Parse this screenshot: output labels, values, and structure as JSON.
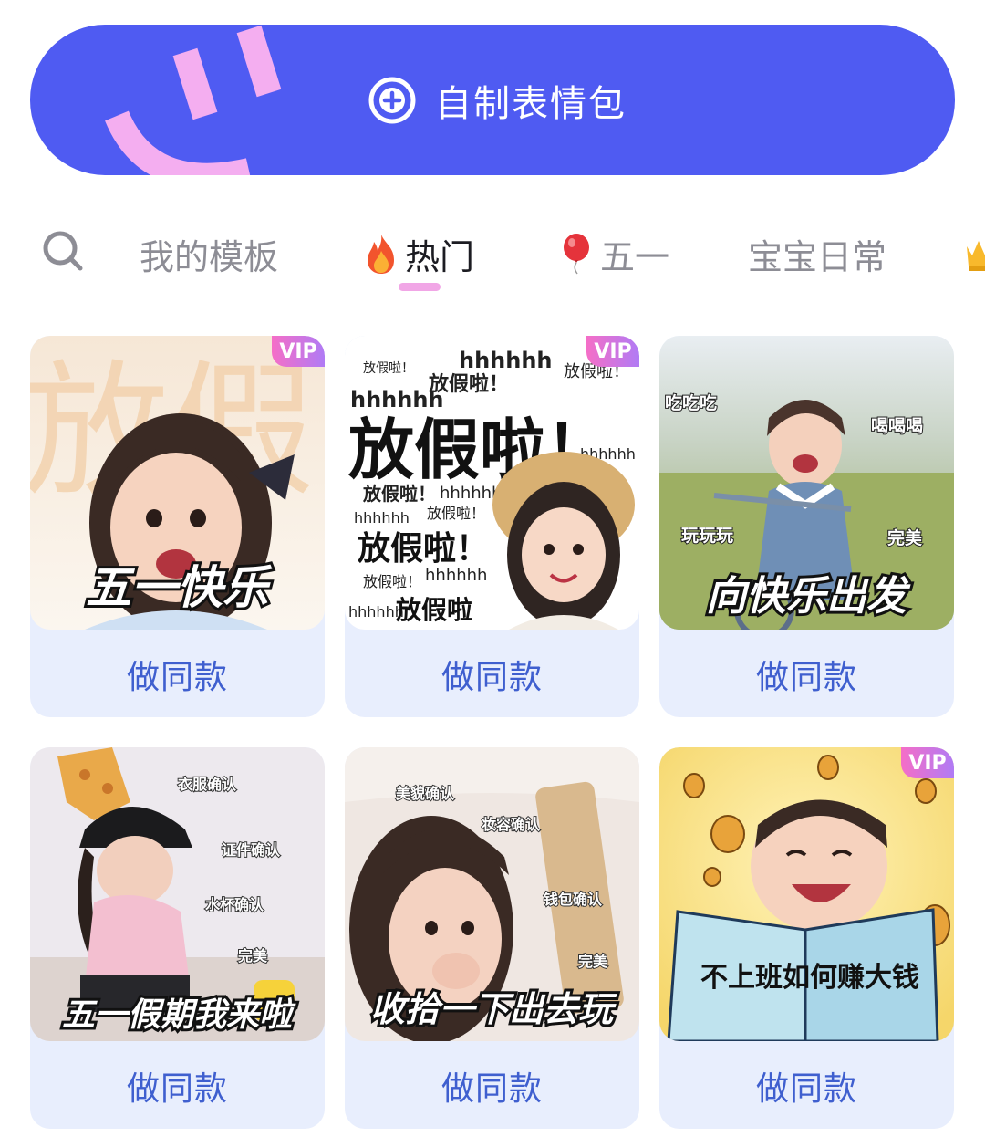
{
  "create_button": {
    "label": "自制表情包"
  },
  "tabs": [
    {
      "label": "我的模板",
      "emoji": ""
    },
    {
      "label": "热门",
      "emoji": "fire-icon"
    },
    {
      "label": "五一",
      "emoji": "balloon-icon"
    },
    {
      "label": "宝宝日常",
      "emoji": ""
    }
  ],
  "active_tab": "热门",
  "colors": {
    "accent": "#4F5BF2",
    "indicator": "#F1A6E6",
    "card_bg": "#E8EEFD",
    "action_text": "#3F5FCF"
  },
  "templates": [
    {
      "caption": "五一快乐",
      "background_text": "放假",
      "vip": "VIP",
      "action": "做同款"
    },
    {
      "caption": "放假啦！",
      "background_text": "hhhhhh",
      "vip": "VIP",
      "action": "做同款"
    },
    {
      "caption": "向快乐出发",
      "stickers": [
        "吃吃吃",
        "喝喝喝",
        "玩玩玩",
        "完美"
      ],
      "action": "做同款"
    },
    {
      "caption": "五一假期我来啦",
      "stickers": [
        "衣服确认",
        "证件确认",
        "水杯确认",
        "完美"
      ],
      "action": "做同款"
    },
    {
      "caption": "收拾一下出去玩",
      "stickers": [
        "美貌确认",
        "妆容确认",
        "钱包确认",
        "完美"
      ],
      "action": "做同款"
    },
    {
      "caption": "不上班如何赚大钱",
      "vip": "VIP",
      "action": "做同款"
    }
  ]
}
